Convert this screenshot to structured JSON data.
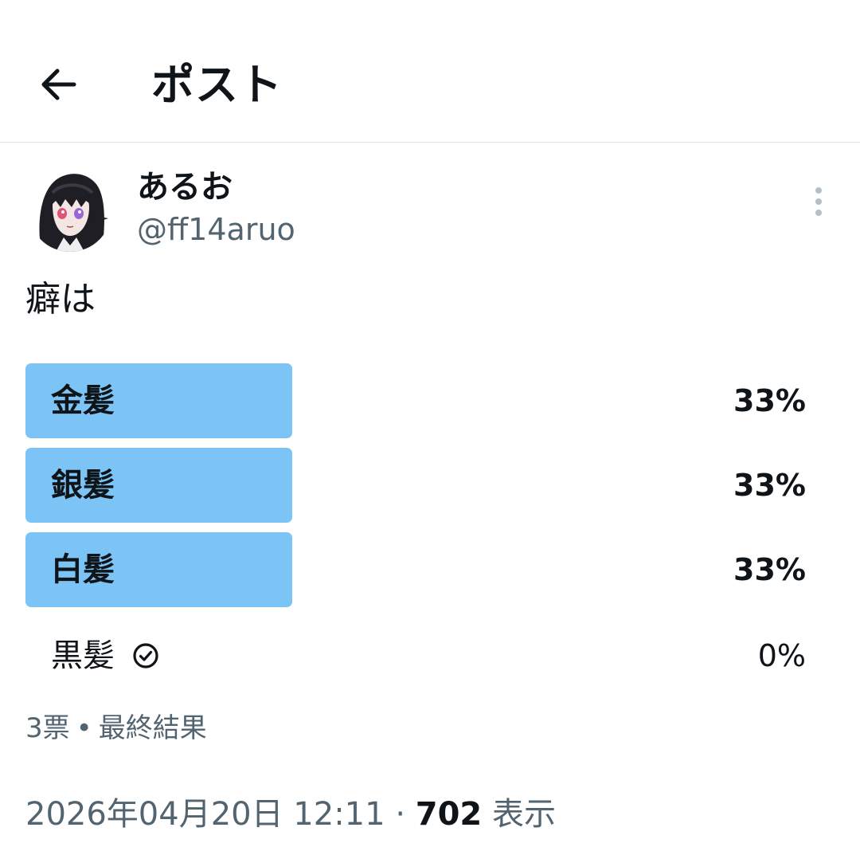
{
  "header": {
    "title": "ポスト"
  },
  "author": {
    "display_name": "あるお",
    "handle": "@ff14aruo"
  },
  "post": {
    "text": "癖は"
  },
  "poll": {
    "options": [
      {
        "label": "金髪",
        "percent": "33%",
        "share": 0.33,
        "leading": true
      },
      {
        "label": "銀髪",
        "percent": "33%",
        "share": 0.33,
        "leading": true
      },
      {
        "label": "白髪",
        "percent": "33%",
        "share": 0.33,
        "leading": true
      },
      {
        "label": "黒髪",
        "percent": "0%",
        "share": 0,
        "leading": false,
        "voted": true
      }
    ],
    "votes": "3票",
    "separator": "•",
    "status": "最終結果"
  },
  "meta": {
    "date": "2026年04月20日 12:11",
    "separator": "·",
    "views_count": "702",
    "views_label": "表示"
  },
  "colors": {
    "poll_bar": "#7cc4f6",
    "secondary_text": "#536471",
    "primary_text": "#0f1419",
    "divider": "#dfe3e6"
  },
  "icons": {
    "back": "arrow-left-icon",
    "more": "more-vertical-icon",
    "voted": "check-circle-icon"
  }
}
